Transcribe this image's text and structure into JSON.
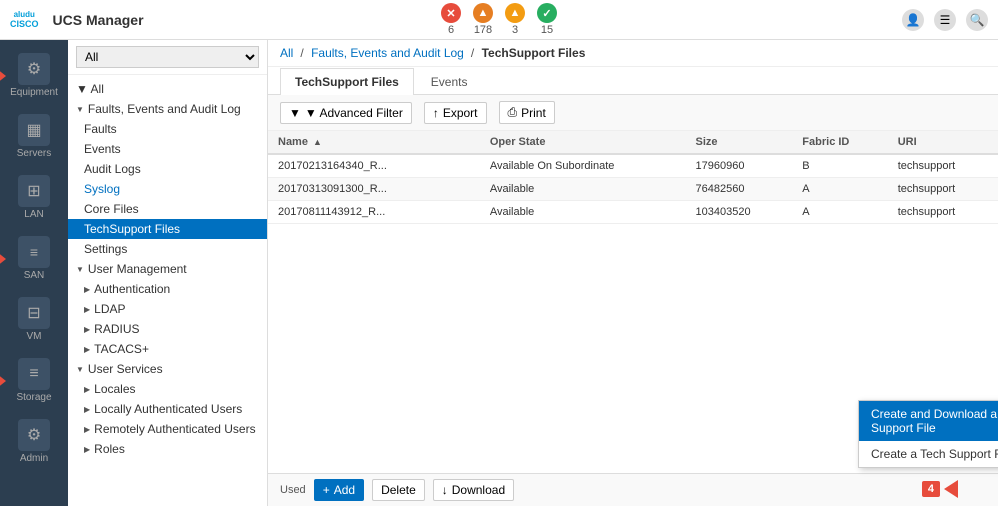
{
  "app": {
    "logo_line1": "aludu",
    "logo_line2": "cisco",
    "title": "UCS Manager"
  },
  "alerts": [
    {
      "count": "6",
      "color": "red",
      "icon": "✕"
    },
    {
      "count": "178",
      "color": "orange",
      "icon": "▲"
    },
    {
      "count": "3",
      "color": "yellow",
      "icon": "▲"
    },
    {
      "count": "15",
      "color": "green",
      "icon": "✓"
    }
  ],
  "sidebar": {
    "items": [
      {
        "id": "equipment",
        "label": "Equipment",
        "icon": "⚙",
        "active": false,
        "arrow": true
      },
      {
        "id": "servers",
        "label": "Servers",
        "icon": "▦",
        "active": false,
        "arrow": false
      },
      {
        "id": "lan",
        "label": "LAN",
        "icon": "⊞",
        "active": false,
        "arrow": false
      },
      {
        "id": "san",
        "label": "SAN",
        "icon": "≡",
        "active": false,
        "arrow": true
      },
      {
        "id": "vm",
        "label": "VM",
        "icon": "⊟",
        "active": false,
        "arrow": false
      },
      {
        "id": "storage",
        "label": "Storage",
        "icon": "≡",
        "active": false,
        "arrow": true
      },
      {
        "id": "admin",
        "label": "Admin",
        "icon": "⚙",
        "active": false,
        "arrow": false
      }
    ]
  },
  "nav_dropdown": {
    "value": "All",
    "options": [
      "All"
    ]
  },
  "nav_tree": [
    {
      "label": "▼ All",
      "level": 0
    },
    {
      "label": "▼ Faults, Events and Audit Log",
      "level": 0
    },
    {
      "label": "Faults",
      "level": 1
    },
    {
      "label": "Events",
      "level": 1
    },
    {
      "label": "Audit Logs",
      "level": 1
    },
    {
      "label": "Syslog",
      "level": 1,
      "link": true
    },
    {
      "label": "Core Files",
      "level": 1
    },
    {
      "label": "TechSupport Files",
      "level": 1,
      "selected": true
    },
    {
      "label": "Settings",
      "level": 1
    },
    {
      "label": "▼ User Management",
      "level": 0
    },
    {
      "label": "▶ Authentication",
      "level": 1
    },
    {
      "label": "▶ LDAP",
      "level": 1
    },
    {
      "label": "▶ RADIUS",
      "level": 1
    },
    {
      "label": "▶ TACACS+",
      "level": 1
    },
    {
      "label": "▼ User Services",
      "level": 0
    },
    {
      "label": "▶ Locales",
      "level": 1
    },
    {
      "label": "▶ Locally Authenticated Users",
      "level": 1
    },
    {
      "label": "▶ Remotely Authenticated Users",
      "level": 1
    },
    {
      "label": "▶ Roles",
      "level": 1
    }
  ],
  "breadcrumb": {
    "items": [
      "All",
      "Faults, Events and Audit Log"
    ],
    "current": "TechSupport Files",
    "separator": "/"
  },
  "tabs": [
    {
      "id": "techsupport",
      "label": "TechSupport Files",
      "active": true
    },
    {
      "id": "events",
      "label": "Events",
      "active": false
    }
  ],
  "toolbar": {
    "advanced_filter": "▼ Advanced Filter",
    "export": "↑ Export",
    "print": "⎙ Print"
  },
  "table": {
    "columns": [
      "Name",
      "",
      "Oper State",
      "Size",
      "Fabric ID",
      "URI"
    ],
    "rows": [
      {
        "name": "20170213164340_R...",
        "oper_state": "Available On Subordinate",
        "size": "17960960",
        "fabric_id": "B",
        "uri": "techsupport"
      },
      {
        "name": "20170313091300_R...",
        "oper_state": "Available",
        "size": "76482560",
        "fabric_id": "A",
        "uri": "techsupport"
      },
      {
        "name": "20170811143912_R...",
        "oper_state": "Available",
        "size": "103403520",
        "fabric_id": "A",
        "uri": "techsupport"
      }
    ]
  },
  "bottom_bar": {
    "add_label": "+ Add",
    "delete_label": "Delete",
    "download_label": "↓ Download",
    "used_text": "Used"
  },
  "dropdown_menu": {
    "items": [
      {
        "label": "Create and Download a Tech Support File",
        "highlighted": true
      },
      {
        "label": "Create a Tech Support File",
        "highlighted": false
      }
    ]
  }
}
